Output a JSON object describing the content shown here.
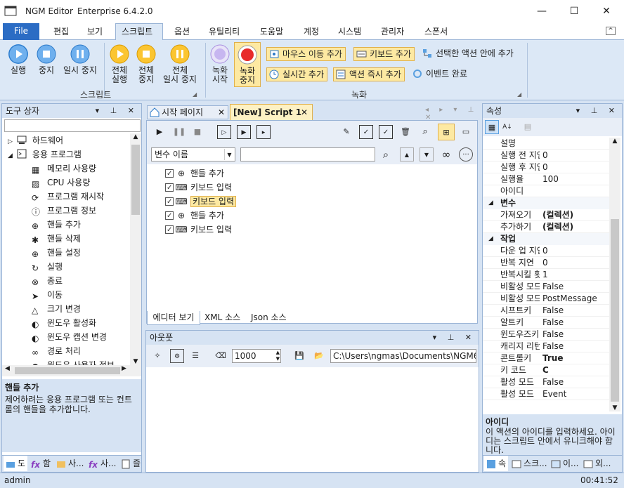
{
  "titlebar": {
    "app": "NGM Editor",
    "edition": "Enterprise 6.4.2.0",
    "minimize": "—",
    "maximize": "☐",
    "close": "✕"
  },
  "menu": {
    "file": "File",
    "tabs": [
      "편집",
      "보기",
      "스크립트",
      "옵션",
      "유틸리티",
      "도움말",
      "계정",
      "시스템",
      "관리자",
      "스폰서"
    ]
  },
  "ribbon": {
    "run": "실행",
    "stop": "중지",
    "pause": "일시 중지",
    "run_all_1": "전체",
    "run_all_2": "실행",
    "stop_all_1": "전체",
    "stop_all_2": "중지",
    "pause_all_1": "전체",
    "pause_all_2": "일시 중지",
    "script_group": "스크립트",
    "rec_start_1": "녹화",
    "rec_start_2": "시작",
    "rec_stop_1": "녹화",
    "rec_stop_2": "중지",
    "add_mouse_move": "마우스 이동 추가",
    "add_keyboard": "키보드 추가",
    "add_in_selected": "선택한 액션 안에 추가",
    "add_realtime": "실시간 추가",
    "add_action_now": "액션 즉시 추가",
    "event_done": "이벤트 완료",
    "record_group": "녹화"
  },
  "toolbox": {
    "title": "도구 상자",
    "categories": [
      {
        "label": "하드웨어",
        "expanded": false
      },
      {
        "label": "응용 프로그램",
        "expanded": true
      }
    ],
    "items": [
      "메모리 사용량",
      "CPU 사용량",
      "프로그램 재시작",
      "프로그램 정보",
      "핸들 추가",
      "핸들 삭제",
      "핸들 설정",
      "실행",
      "종료",
      "이동",
      "크기 변경",
      "윈도우 활성화",
      "윈도우 캡션 변경",
      "경로 처리",
      "윈도우 사용자 정보"
    ],
    "desc_title": "핸들 추가",
    "desc_text": "제어하려는 응용 프로그램 또는 컨트롤의 핸들을 추가합니다.",
    "bottom_tabs": [
      "도",
      "함",
      "사...",
      "사...",
      "즐"
    ]
  },
  "editor": {
    "tab_start": "시작 페이지",
    "tab_script": "[New] Script 1",
    "var_select": "변수 이름",
    "search_value": "",
    "actions": [
      "핸들 추가",
      "키보드 입력",
      "키보드 입력",
      "핸들 추가",
      "키보드 입력"
    ],
    "selected_index": 2,
    "view_tabs": [
      "에디터 보기",
      "XML 소스",
      "Json 소스"
    ]
  },
  "output": {
    "title": "아웃풋",
    "interval": "1000",
    "path": "C:\\Users\\ngmas\\Documents\\NGM6\\"
  },
  "properties": {
    "title": "속성",
    "rows_top": [
      {
        "k": "설명",
        "v": ""
      },
      {
        "k": "실행 전 지연",
        "v": "0"
      },
      {
        "k": "실행 후 지연",
        "v": "0"
      },
      {
        "k": "실행율",
        "v": "100"
      },
      {
        "k": "아이디",
        "v": ""
      }
    ],
    "cat_vars": "변수",
    "rows_vars": [
      {
        "k": "가져오기",
        "v": "(컬렉션)"
      },
      {
        "k": "추가하기",
        "v": "(컬렉션)"
      }
    ],
    "cat_work": "작업",
    "rows_work": [
      {
        "k": "다운 업 지연",
        "v": "0"
      },
      {
        "k": "반복 지연",
        "v": "0"
      },
      {
        "k": "반복시킬 횟수",
        "v": "1"
      },
      {
        "k": "비활성 모드",
        "v": "False"
      },
      {
        "k": "비활성 모드 방식",
        "v": "PostMessage"
      },
      {
        "k": "시프트키",
        "v": "False"
      },
      {
        "k": "알트키",
        "v": "False"
      },
      {
        "k": "윈도우즈키",
        "v": "False"
      },
      {
        "k": "캐리지 리턴",
        "v": "False"
      },
      {
        "k": "콘트롤키",
        "v": "True"
      },
      {
        "k": "키 코드",
        "v": "C"
      },
      {
        "k": "활성 모드",
        "v": "False"
      },
      {
        "k": "활성 모드",
        "v": "Event"
      }
    ],
    "desc_title": "아이디",
    "desc_text": "이 액션의 아이디를 입력하세요. 아이디는 스크립트 안에서 유니크해야 합니다.",
    "bottom_tabs": [
      "속",
      "스크...",
      "이...",
      "외..."
    ]
  },
  "status": {
    "user": "admin",
    "time": "00:41:52"
  }
}
